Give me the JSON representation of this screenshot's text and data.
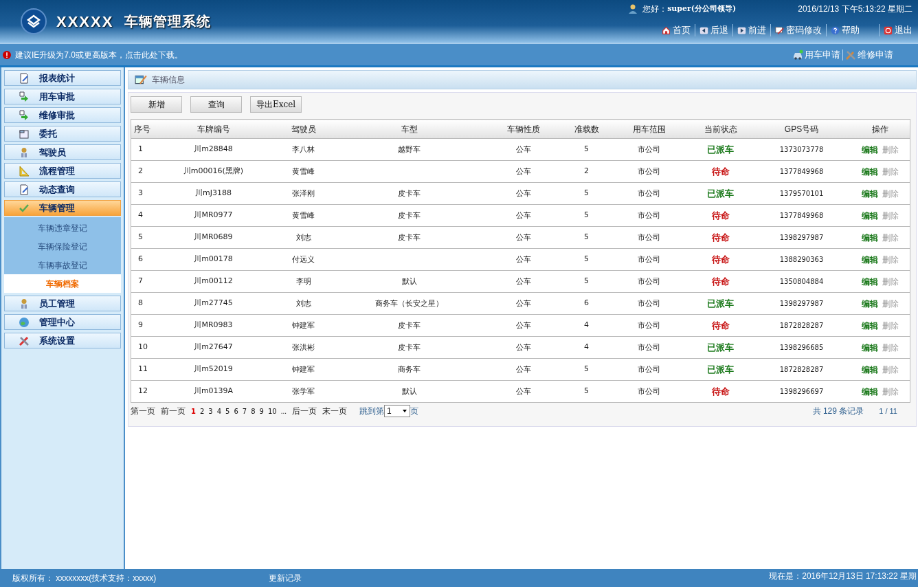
{
  "header": {
    "logo_text": "XXXXX",
    "system_title": "车辆管理系统",
    "greeting": "您好：",
    "user": "super(分公司领导)",
    "datetime": "2016/12/13 下午5:13:22 星期二",
    "nav_links": [
      "首页",
      "后退",
      "前进",
      "密码修改",
      "帮助",
      "退出"
    ]
  },
  "notice": "建议IE升级为7.0或更高版本，点击此处下载。",
  "quick_links": [
    "用车申请",
    "维修申请"
  ],
  "sidebar": {
    "items": [
      {
        "label": "报表统计",
        "selected": false
      },
      {
        "label": "用车审批",
        "selected": false
      },
      {
        "label": "维修审批",
        "selected": false
      },
      {
        "label": "委托",
        "selected": false
      },
      {
        "label": "驾驶员",
        "selected": false
      },
      {
        "label": "流程管理",
        "selected": false
      },
      {
        "label": "动态查询",
        "selected": false
      },
      {
        "label": "车辆管理",
        "selected": true,
        "expanded": true,
        "children": [
          {
            "label": "车辆违章登记",
            "selected": false
          },
          {
            "label": "车辆保险登记",
            "selected": false
          },
          {
            "label": "车辆事故登记",
            "selected": false
          },
          {
            "label": "车辆档案",
            "selected": true
          }
        ]
      },
      {
        "label": "员工管理",
        "selected": false
      },
      {
        "label": "管理中心",
        "selected": false
      },
      {
        "label": "系统设置",
        "selected": false
      }
    ]
  },
  "panel_title": "车辆信息",
  "toolbar": [
    "新增",
    "查询",
    "导出Excel"
  ],
  "table": {
    "columns": [
      "序号",
      "车牌编号",
      "驾驶员",
      "车型",
      "车辆性质",
      "准载数",
      "用车范围",
      "当前状态",
      "GPS号码",
      "操作"
    ],
    "rows": [
      {
        "no": "1",
        "plate": "川m28848",
        "driver": "李八林",
        "type": "越野车",
        "nature": "公车",
        "seats": "5",
        "scope": "市公司",
        "status": "已派车",
        "color": "#1c7a1c",
        "gps": "1373073778",
        "edit": "编辑",
        "delete": "删除"
      },
      {
        "no": "2",
        "plate": "川m00016(黑牌)",
        "driver": "黄雪峰",
        "nature": "公车",
        "seats": "2",
        "scope": "市公司",
        "status": "待命",
        "color": "#c81414",
        "gps": "1377849968",
        "edit": "编辑",
        "delete": "删除"
      },
      {
        "no": "3",
        "plate": "川mJ3188",
        "driver": "张泽刚",
        "type": "皮卡车",
        "nature": "公车",
        "seats": "5",
        "scope": "市公司",
        "status": "已派车",
        "color": "#1c7a1c",
        "gps": "1379570101",
        "edit": "编辑",
        "delete": "删除"
      },
      {
        "no": "4",
        "plate": "川MR0977",
        "driver": "黄雪峰",
        "type": "皮卡车",
        "nature": "公车",
        "seats": "5",
        "scope": "市公司",
        "status": "待命",
        "color": "#c81414",
        "gps": "1377849968",
        "edit": "编辑",
        "delete": "删除"
      },
      {
        "no": "5",
        "plate": "川MR0689",
        "driver": "刘志",
        "type": "皮卡车",
        "nature": "公车",
        "seats": "5",
        "scope": "市公司",
        "status": "待命",
        "color": "#c81414",
        "gps": "1398297987",
        "edit": "编辑",
        "delete": "删除"
      },
      {
        "no": "6",
        "plate": "川m00178",
        "driver": "付远义",
        "nature": "公车",
        "seats": "5",
        "scope": "市公司",
        "status": "待命",
        "color": "#c81414",
        "gps": "1388290363",
        "edit": "编辑",
        "delete": "删除"
      },
      {
        "no": "7",
        "plate": "川m00112",
        "driver": "李明",
        "type": "默认",
        "nature": "公车",
        "seats": "5",
        "scope": "市公司",
        "status": "待命",
        "color": "#c81414",
        "gps": "1350804884",
        "edit": "编辑",
        "delete": "删除"
      },
      {
        "no": "8",
        "plate": "川m27745",
        "driver": "刘志",
        "type": "商务车（长安之星）",
        "nature": "公车",
        "seats": "6",
        "scope": "市公司",
        "status": "已派车",
        "color": "#1c7a1c",
        "gps": "1398297987",
        "edit": "编辑",
        "delete": "删除"
      },
      {
        "no": "9",
        "plate": "川MR0983",
        "driver": "钟建军",
        "type": "皮卡车",
        "nature": "公车",
        "seats": "4",
        "scope": "市公司",
        "status": "待命",
        "color": "#c81414",
        "gps": "1872828287",
        "edit": "编辑",
        "delete": "删除"
      },
      {
        "no": "10",
        "plate": "川m27647",
        "driver": "张洪彬",
        "type": "皮卡车",
        "nature": "公车",
        "seats": "4",
        "scope": "市公司",
        "status": "已派车",
        "color": "#1c7a1c",
        "gps": "1398296685",
        "edit": "编辑",
        "delete": "删除"
      },
      {
        "no": "11",
        "plate": "川m52019",
        "driver": "钟建军",
        "type": "商务车",
        "nature": "公车",
        "seats": "5",
        "scope": "市公司",
        "status": "已派车",
        "color": "#1c7a1c",
        "gps": "1872828287",
        "edit": "编辑",
        "delete": "删除"
      },
      {
        "no": "12",
        "plate": "川m0139A",
        "driver": "张学军",
        "type": "默认",
        "nature": "公车",
        "seats": "5",
        "scope": "市公司",
        "status": "待命",
        "color": "#c81414",
        "gps": "1398296697",
        "edit": "编辑",
        "delete": "删除"
      }
    ]
  },
  "pagination": {
    "first": "第一页",
    "prev": "前一页",
    "pages": [
      {
        "label": "1",
        "selected": true
      },
      {
        "label": "2",
        "selected": false
      },
      {
        "label": "3",
        "selected": false
      },
      {
        "label": "4",
        "selected": false
      },
      {
        "label": "5",
        "selected": false
      },
      {
        "label": "6",
        "selected": false
      },
      {
        "label": "7",
        "selected": false
      },
      {
        "label": "8",
        "selected": false
      },
      {
        "label": "9",
        "selected": false
      },
      {
        "label": "10",
        "selected": false
      }
    ],
    "ellipsis": "...",
    "next": "后一页",
    "last": "末一页",
    "jump_prefix": "跳到第",
    "jump_value": "1",
    "jump_suffix": "页",
    "total": "共 129 条记录",
    "page_of": "1 / 11"
  },
  "footer": {
    "copyright": "版权所有： xxxxxxxx(技术支持：xxxxx)",
    "changelog": "更新记录",
    "now": "现在是：2016年12月13日 17:13:22 星期"
  }
}
